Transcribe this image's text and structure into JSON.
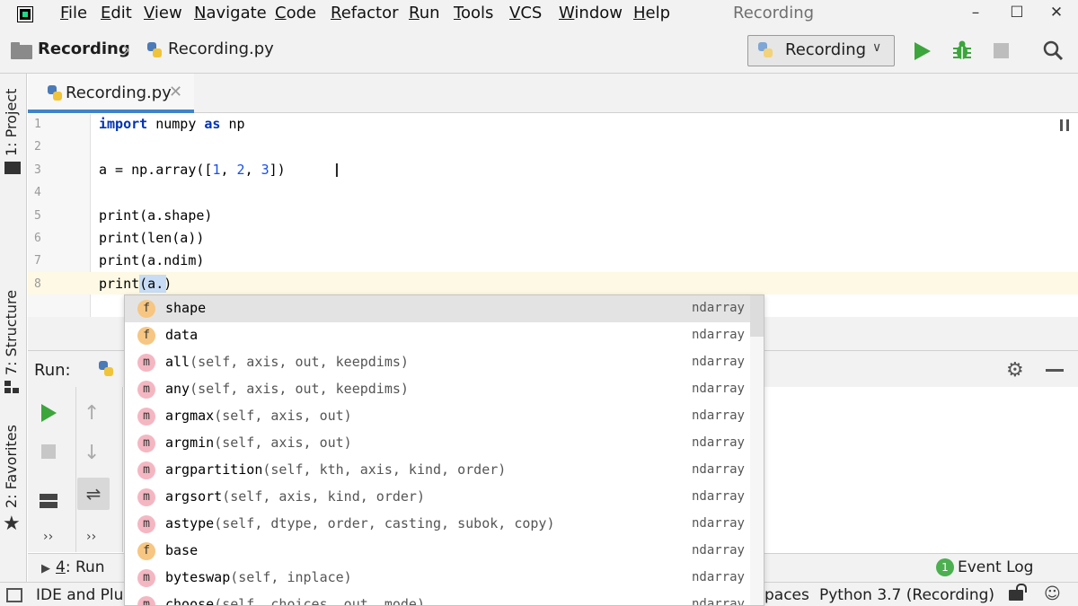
{
  "menubar": {
    "items": [
      {
        "mnemonic": "F",
        "rest": "ile"
      },
      {
        "mnemonic": "E",
        "rest": "dit"
      },
      {
        "mnemonic": "V",
        "rest": "iew"
      },
      {
        "mnemonic": "N",
        "rest": "avigate"
      },
      {
        "mnemonic": "C",
        "rest": "ode"
      },
      {
        "mnemonic": "R",
        "rest": "efactor"
      },
      {
        "mnemonic": "R",
        "rest": "un"
      },
      {
        "mnemonic": "T",
        "rest": "ools"
      },
      {
        "mnemonic": "V",
        "rest": "CS"
      },
      {
        "mnemonic": "W",
        "rest": "indow"
      },
      {
        "mnemonic": "H",
        "rest": "elp"
      }
    ],
    "window_title": "Recording",
    "controls": {
      "minimize": "–",
      "maximize": "☐",
      "close": "✕"
    }
  },
  "navbar": {
    "project": "Recording",
    "file": "Recording.py",
    "run_config": "Recording"
  },
  "left_tabs": {
    "project": "1: Project",
    "structure": "7: Structure",
    "favorites": "2: Favorites"
  },
  "editor": {
    "tab_label": "Recording.py",
    "line_numbers": [
      "1",
      "2",
      "3",
      "4",
      "5",
      "6",
      "7",
      "8"
    ],
    "lines": {
      "l1_kw1": "import",
      "l1_mid": " numpy ",
      "l1_kw2": "as",
      "l1_end": " np",
      "l3_start": "a = np.array([",
      "l3_n1": "1",
      "l3_c1": ", ",
      "l3_n2": "2",
      "l3_c2": ", ",
      "l3_n3": "3",
      "l3_end": "])",
      "l5": "print(a.shape)",
      "l6": "print(len(a))",
      "l7": "print(a.ndim)",
      "l8": "print(a.)"
    }
  },
  "run_panel": {
    "title": "Run:",
    "more": "››"
  },
  "bottom_tabs": {
    "run_num": "4",
    "run_rest": ": Run",
    "event_count": "1",
    "event_log": "Event Log"
  },
  "status": {
    "message": "IDE and Plugin Updates",
    "spaces": "paces",
    "interpreter": "Python 3.7 (Recording)"
  },
  "completion": {
    "items": [
      {
        "kind": "f",
        "name": "shape",
        "params": "",
        "type": "ndarray"
      },
      {
        "kind": "f",
        "name": "data",
        "params": "",
        "type": "ndarray"
      },
      {
        "kind": "m",
        "name": "all",
        "params": "(self, axis, out, keepdims)",
        "type": "ndarray"
      },
      {
        "kind": "m",
        "name": "any",
        "params": "(self, axis, out, keepdims)",
        "type": "ndarray"
      },
      {
        "kind": "m",
        "name": "argmax",
        "params": "(self, axis, out)",
        "type": "ndarray"
      },
      {
        "kind": "m",
        "name": "argmin",
        "params": "(self, axis, out)",
        "type": "ndarray"
      },
      {
        "kind": "m",
        "name": "argpartition",
        "params": "(self, kth, axis, kind, order)",
        "type": "ndarray"
      },
      {
        "kind": "m",
        "name": "argsort",
        "params": "(self, axis, kind, order)",
        "type": "ndarray"
      },
      {
        "kind": "m",
        "name": "astype",
        "params": "(self, dtype, order, casting, subok, copy)",
        "type": "ndarray"
      },
      {
        "kind": "f",
        "name": "base",
        "params": "",
        "type": "ndarray"
      },
      {
        "kind": "m",
        "name": "byteswap",
        "params": "(self, inplace)",
        "type": "ndarray"
      },
      {
        "kind": "m",
        "name": "choose",
        "params": "(self, choices, out, mode)",
        "type": "ndarray"
      }
    ]
  }
}
